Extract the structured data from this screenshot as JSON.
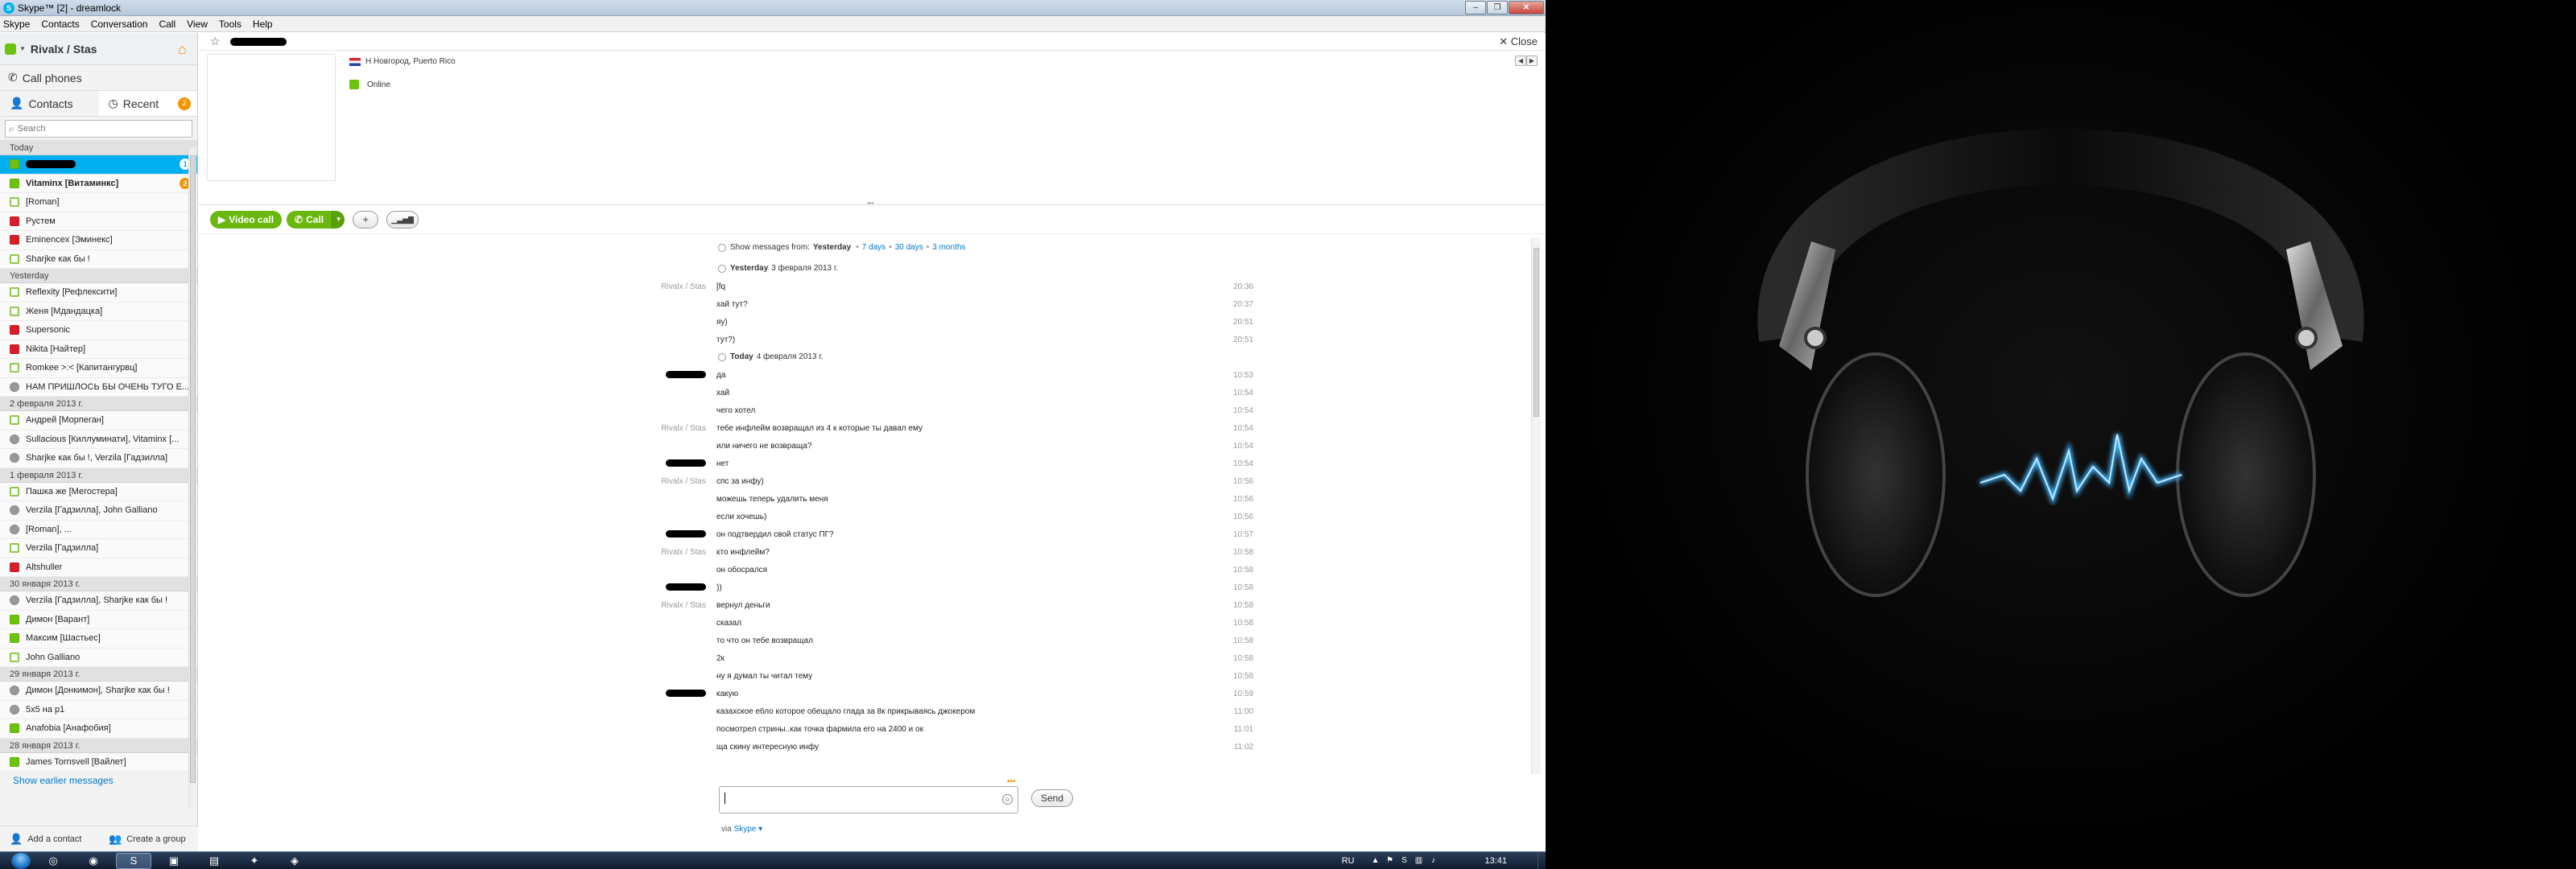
{
  "window": {
    "title": "Skype™ [2] - dreamlock",
    "controls": [
      "–",
      "❐",
      "✕"
    ]
  },
  "menu": [
    "Skype",
    "Contacts",
    "Conversation",
    "Call",
    "View",
    "Tools",
    "Help"
  ],
  "user": {
    "name": "Rivalx / Stas"
  },
  "sidebar": {
    "call_phones": "Call phones",
    "tab_contacts": "Contacts",
    "tab_recent": "Recent",
    "recent_badge": "2",
    "search_placeholder": "Search",
    "groups": [
      {
        "header": "Today",
        "items": [
          {
            "name": "",
            "status": "online",
            "selected": true,
            "redacted": true,
            "count": "1"
          },
          {
            "name": "Vitaminx [Витаминкс]",
            "status": "online",
            "bold": true,
            "count": "2"
          },
          {
            "name": "[Roman]",
            "status": "offline"
          },
          {
            "name": "Рустем",
            "status": "away"
          },
          {
            "name": "Eminencex [Эминекс]",
            "status": "away"
          },
          {
            "name": "Sharjke как бы !",
            "status": "offline"
          }
        ]
      },
      {
        "header": "Yesterday",
        "items": [
          {
            "name": "Reflexity [Рефлексити]",
            "status": "offline"
          },
          {
            "name": "Женя [Мдандацка]",
            "status": "offline"
          },
          {
            "name": "Supersonic",
            "status": "away"
          },
          {
            "name": "Nikita [Найтер]",
            "status": "away"
          },
          {
            "name": "Romkee >:< [Капитангурвц]",
            "status": "offline"
          },
          {
            "name": "НАМ ПРИШЛОСЬ БЫ ОЧЕНЬ ТУГО Е...",
            "status": "group"
          }
        ]
      },
      {
        "header": "2 февраля 2013 г.",
        "items": [
          {
            "name": "Андрей [Морпеган]",
            "status": "offline"
          },
          {
            "name": "Sullacious [Киллуминати], Vitaminx [...",
            "status": "group"
          },
          {
            "name": "Sharjke как бы !, Verzila [Гадзилла]",
            "status": "group"
          }
        ]
      },
      {
        "header": "1 февраля 2013 г.",
        "items": [
          {
            "name": "Пашка же [Мегостера]",
            "status": "offline"
          },
          {
            "name": "Verzila [Гадзилла], John Galliano",
            "status": "group"
          },
          {
            "name": "[Roman], ...",
            "status": "group"
          },
          {
            "name": "Verzila [Гадзилла]",
            "status": "offline"
          },
          {
            "name": "Altshuller",
            "status": "away"
          }
        ]
      },
      {
        "header": "30 января 2013 г.",
        "items": [
          {
            "name": "Verzila [Гадзилла], Sharjke как бы !",
            "status": "group"
          },
          {
            "name": "Димон [Варант]",
            "status": "online"
          },
          {
            "name": "Максим [Шастьес]",
            "status": "online"
          },
          {
            "name": "John Galliano",
            "status": "offline"
          }
        ]
      },
      {
        "header": "29 января 2013 г.",
        "items": [
          {
            "name": "Димон [Донкимон], Sharjke как бы !",
            "status": "group"
          },
          {
            "name": "5x5 на р1",
            "status": "group"
          },
          {
            "name": "Anafobia [Анафобия]",
            "status": "online"
          }
        ]
      },
      {
        "header": "28 января 2013 г.",
        "items": [
          {
            "name": "James Tornsvell [Вайлет]",
            "status": "online"
          }
        ]
      }
    ],
    "show_earlier": "Show earlier messages",
    "add_contact": "Add a contact",
    "create_group": "Create a group"
  },
  "conversation": {
    "close_label": "Close",
    "profile_location": "Н Новгород, Puerto Rico",
    "profile_status": "Online",
    "video_call": "Video call",
    "call": "Call",
    "add_icon": "+",
    "signal_icon": "signal-icon",
    "history": {
      "prefix": "Show messages from:",
      "current": "Yesterday",
      "links": [
        "7 days",
        "30 days",
        "3 months"
      ]
    },
    "days": [
      {
        "label": "Yesterday",
        "date": "3 февраля 2013 г."
      },
      {
        "label": "Today",
        "date": "4 февраля 2013 г."
      }
    ],
    "messages_yesterday": [
      {
        "sender": "Rivalx / Stas",
        "text": "[fq",
        "time": "20:36"
      },
      {
        "sender": "",
        "text": "хай тут?",
        "time": "20:37"
      },
      {
        "sender": "",
        "text": "яу)",
        "time": "20:51"
      },
      {
        "sender": "",
        "text": "тут?)",
        "time": "20:51"
      }
    ],
    "messages_today": [
      {
        "sender": "",
        "redacted": true,
        "text": "да",
        "time": "10:53"
      },
      {
        "sender": "",
        "text": "хай",
        "time": "10:54"
      },
      {
        "sender": "",
        "text": "чего хотел",
        "time": "10:54"
      },
      {
        "sender": "Rivalx / Stas",
        "text": "тебе инфлейм возвращал из 4 к которые ты давал ему",
        "time": "10:54"
      },
      {
        "sender": "",
        "text": "или ничего не возвраща?",
        "time": "10:54"
      },
      {
        "sender": "",
        "redacted": true,
        "text": "нет",
        "time": "10:54"
      },
      {
        "sender": "Rivalx / Stas",
        "text": "спс за инфу)",
        "time": "10:56"
      },
      {
        "sender": "",
        "text": "можешь теперь удалить меня",
        "time": "10:56"
      },
      {
        "sender": "",
        "text": "если хочешь)",
        "time": "10:56"
      },
      {
        "sender": "",
        "redacted": true,
        "text": "он подтвердил свой статус ПГ?",
        "time": "10:57"
      },
      {
        "sender": "Rivalx / Stas",
        "text": "кто инфлейм?",
        "time": "10:58"
      },
      {
        "sender": "",
        "text": "он обосрался",
        "time": "10:58"
      },
      {
        "sender": "",
        "redacted": true,
        "text": "))",
        "time": "10:58"
      },
      {
        "sender": "Rivalx / Stas",
        "text": "вернул деньги",
        "time": "10:58"
      },
      {
        "sender": "",
        "text": "сказал",
        "time": "10:58"
      },
      {
        "sender": "",
        "text": "то что он тебе возвращал",
        "time": "10:58"
      },
      {
        "sender": "",
        "text": "2к",
        "time": "10:58"
      },
      {
        "sender": "",
        "text": "ну я думал ты читал тему",
        "time": "10:58"
      },
      {
        "sender": "",
        "redacted": true,
        "text": "какую",
        "time": "10:59"
      },
      {
        "sender": "",
        "text": "казахское ебло которое обещало глада за 8к прикрываясь джокером",
        "time": "11:00"
      },
      {
        "sender": "",
        "text": "посмотрел стрины..как точка фармила его на 2400 и ок",
        "time": "11:01"
      },
      {
        "sender": "",
        "text": "ща скину интересную инфу",
        "time": "11:02"
      }
    ],
    "typing": "•••",
    "send": "Send",
    "via_label": "via",
    "via_link": "Skype ▾"
  },
  "taskbar": {
    "items": [
      "chrome-icon",
      "firefox-icon",
      "skype-icon",
      "cmd-icon",
      "notepad-icon",
      "game-icon",
      "network-icon"
    ],
    "lang": "RU",
    "time": "13:41"
  },
  "colors": {
    "accent": "#00aff0",
    "green": "#6ab70e",
    "orange": "#f29400",
    "away": "#d61f2b"
  }
}
